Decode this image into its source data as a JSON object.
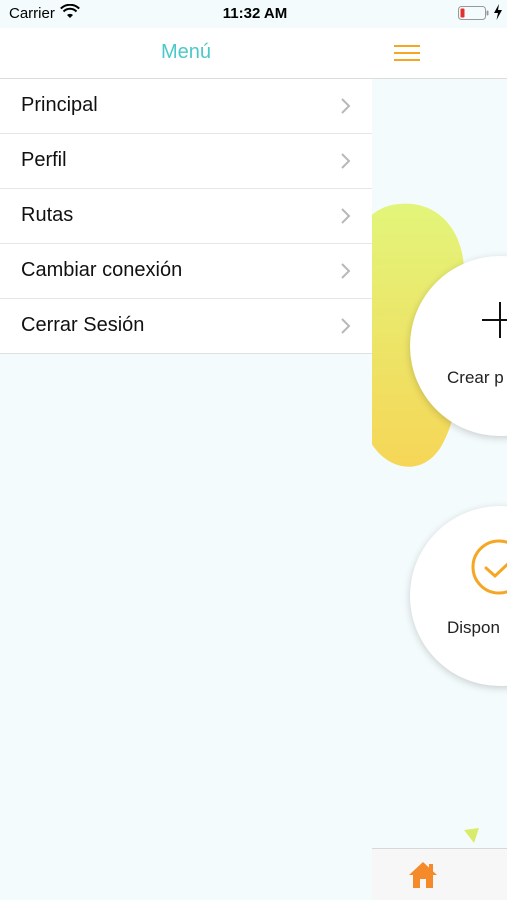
{
  "status_bar": {
    "carrier": "Carrier",
    "time": "11:32 AM"
  },
  "menu": {
    "title": "Menú",
    "items": [
      {
        "label": "Principal"
      },
      {
        "label": "Perfil"
      },
      {
        "label": "Rutas"
      },
      {
        "label": "Cambiar conexión"
      },
      {
        "label": "Cerrar Sesión"
      }
    ]
  },
  "main": {
    "create_card_label": "Crear p",
    "available_card_label": "Dispon"
  },
  "colors": {
    "accent_teal": "#4bc9c8",
    "accent_orange": "#f5a623",
    "chevron_gray": "#b8b8b8",
    "blob_yellow": "#f4df5a",
    "blob_green": "#e2f57a"
  },
  "icons": [
    "wifi-icon",
    "battery-icon",
    "charging-bolt-icon",
    "chevron-right-icon",
    "hamburger-icon",
    "plus-icon",
    "check-circle-icon",
    "home-icon"
  ]
}
